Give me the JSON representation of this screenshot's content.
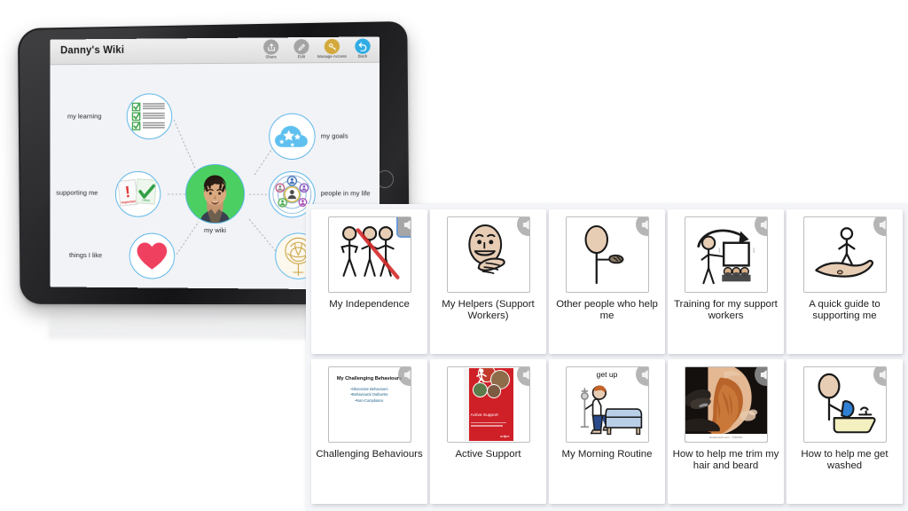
{
  "tablet": {
    "app": {
      "title": "Danny's Wiki",
      "toolbar": [
        {
          "label": "Share",
          "icon": "share-icon",
          "color": "#a4a4a4"
        },
        {
          "label": "Edit",
          "icon": "pencil-icon",
          "color": "#a4a4a4"
        },
        {
          "label": "Manage Access",
          "icon": "key-icon",
          "color": "#d4a93c"
        },
        {
          "label": "Back",
          "icon": "back-arrow-icon",
          "color": "#30ace4"
        }
      ],
      "center_node": {
        "label": "my wiki",
        "icon": "person-photo-avatar",
        "color": "#4bcf62"
      },
      "nodes": [
        {
          "label": "my learning",
          "icon": "checklist-icon",
          "side": "left"
        },
        {
          "label": "supporting me",
          "icon": "important-notes-icon",
          "side": "left"
        },
        {
          "label": "things I like",
          "icon": "heart-icon",
          "side": "left"
        },
        {
          "label": "my goals",
          "icon": "stars-cloud-icon",
          "side": "right"
        },
        {
          "label": "people in my life",
          "icon": "people-network-icon",
          "side": "right"
        },
        {
          "label": "",
          "icon": "tree-of-life-icon",
          "side": "right"
        }
      ]
    }
  },
  "grid": {
    "cards": [
      {
        "label": "My Independence",
        "icon": "stick-figures-crossed-icon",
        "speaker": "speaker-icon",
        "speaker_focused": true
      },
      {
        "label": "My Helpers (Support Workers)",
        "icon": "smiling-face-helping-hand-icon",
        "speaker": "speaker-icon",
        "speaker_focused": false
      },
      {
        "label": "Other people who help me",
        "icon": "person-holding-object-icon",
        "speaker": "speaker-icon",
        "speaker_focused": false
      },
      {
        "label": "Training for my support workers",
        "icon": "presenter-whiteboard-audience-icon",
        "speaker": "speaker-icon",
        "speaker_focused": false
      },
      {
        "label": "A quick guide to supporting me",
        "icon": "person-on-hand-icon",
        "speaker": "speaker-icon",
        "speaker_focused": false
      },
      {
        "label": "Challenging Behaviours",
        "icon": "document-thumbnail",
        "speaker": "speaker-icon",
        "speaker_focused": false,
        "thumb": {
          "title": "My Challenging Behaviours",
          "bullets": [
            "•Obsessive Behaviours",
            "•Behavioural Outbursts",
            "•Non-Compliance"
          ]
        }
      },
      {
        "label": "Active Support",
        "icon": "red-booklet-thumbnail",
        "speaker": "speaker-icon",
        "speaker_focused": false,
        "thumb": {
          "title": "Active Support"
        }
      },
      {
        "label": "My Morning Routine",
        "icon": "person-getting-out-of-bed-icon",
        "speaker": "speaker-icon",
        "speaker_focused": false,
        "thumb": {
          "caption": "get up"
        }
      },
      {
        "label": "How to help me trim my hair and beard",
        "icon": "beard-trimming-photo",
        "speaker": "speaker-icon",
        "speaker_focused": false,
        "thumb": {
          "watermark": "shutterstock.com · 7766702"
        }
      },
      {
        "label": "How to help me get washed",
        "icon": "person-washing-at-sink-icon",
        "speaker": "speaker-icon",
        "speaker_focused": false
      }
    ]
  },
  "colors": {
    "node_ring": "#5bb6e8",
    "center_green": "#4bcf62",
    "panel_bg": "#f4f5f8",
    "screen_bg": "#f2f3f7",
    "focus_blue": "#6b9ad6"
  }
}
